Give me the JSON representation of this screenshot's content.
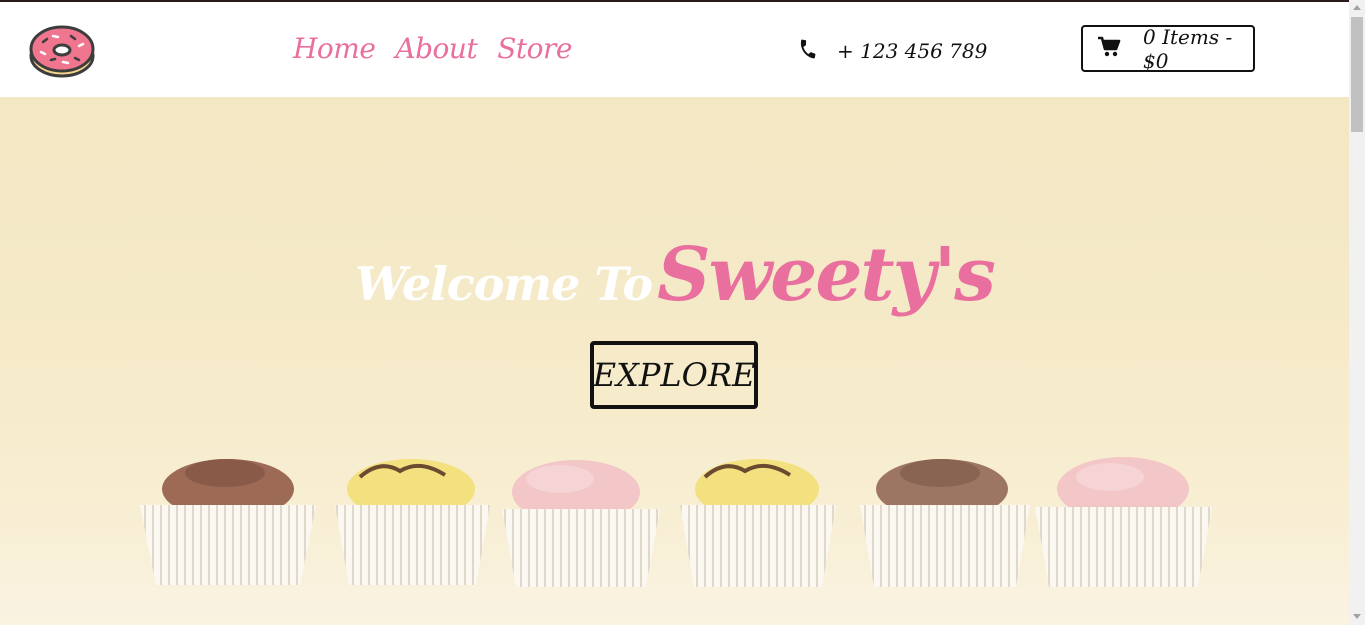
{
  "nav": {
    "logo_icon": "donut-icon",
    "links": [
      "Home",
      "About",
      "Store"
    ],
    "phone": {
      "icon": "phone-icon",
      "number": "+ 123 456 789"
    },
    "cart": {
      "icon": "cart-icon",
      "label": "0 Items - $0"
    }
  },
  "hero": {
    "welcome": "Welcome To",
    "brand": "Sweety's",
    "button": "EXPLORE"
  },
  "colors": {
    "accent_pink": "#e96f9f",
    "text_dark": "#111111",
    "hero_bg": "#f4e8c6"
  }
}
